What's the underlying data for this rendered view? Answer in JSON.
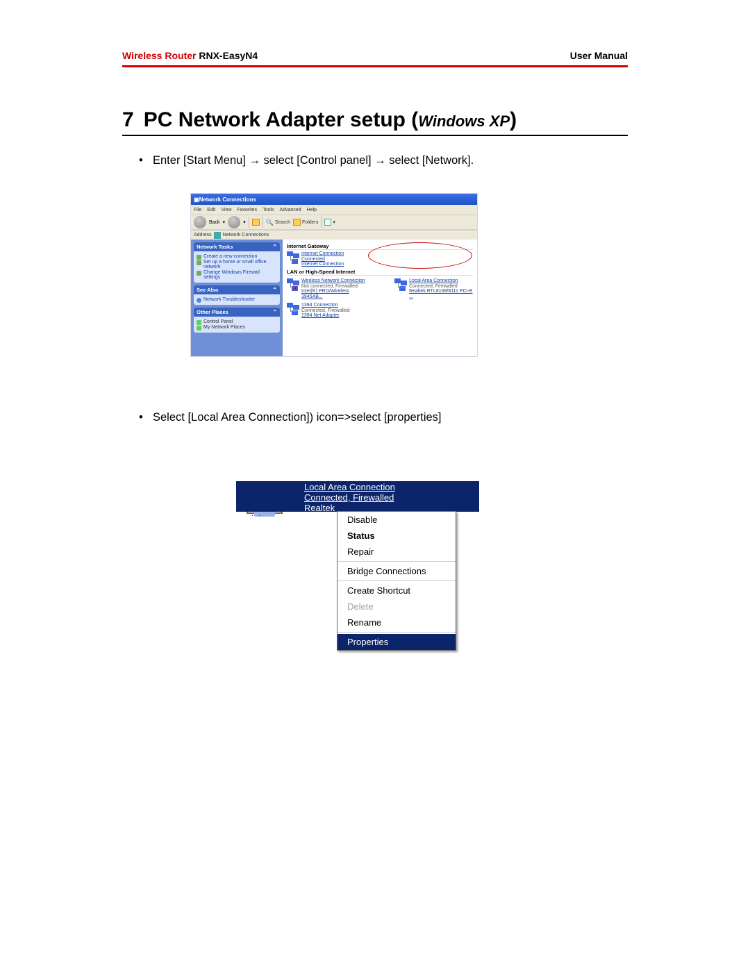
{
  "header": {
    "brand_red": "Wireless Router",
    "brand_black": " RNX-EasyN4",
    "right": "User Manual"
  },
  "heading": {
    "num": "7",
    "title": "PC Network Adapter setup (",
    "sub": "Windows XP",
    "close": ")"
  },
  "bullets": {
    "b1": "Enter [Start Menu] → select [Control panel] → select [Network].",
    "b2": "Select [Local Area Connection]) icon=>select [properties]"
  },
  "shot1": {
    "title": "Network Connections",
    "menu": {
      "file": "File",
      "edit": "Edit",
      "view": "View",
      "fav": "Favorites",
      "tools": "Tools",
      "adv": "Advanced",
      "help": "Help"
    },
    "toolbar": {
      "back": "Back",
      "search": "Search",
      "folders": "Folders"
    },
    "addr": {
      "label": "Address",
      "value": "Network Connections"
    },
    "panel_tasks": {
      "title": "Network Tasks",
      "items": [
        "Create a new connection",
        "Set up a home or small office network",
        "Change Windows Firewall settings"
      ]
    },
    "panel_seealso": {
      "title": "See Also",
      "item": "Network Troubleshooter"
    },
    "panel_other": {
      "title": "Other Places",
      "items": [
        "Control Panel",
        "My Network Places"
      ]
    },
    "grp_gateway": "Internet Gateway",
    "ic": {
      "name": "Internet Connection",
      "status": "Connected",
      "sub": "Internet Connection"
    },
    "grp_lan": "LAN or High-Speed Internet",
    "wnc": {
      "name": "Wireless Network Connection",
      "status": "Not connected, Firewalled",
      "sub": "Intel(R) PRO/Wireless 3945AB..."
    },
    "lac": {
      "name": "Local Area Connection",
      "status": "Connected, Firewalled",
      "sub": "Realtek RTL8168/8111 PCI-E ..."
    },
    "c1394": {
      "name": "1394 Connection",
      "status": "Connected, Firewalled",
      "sub": "1394 Net Adapter"
    }
  },
  "shot2": {
    "line1": "Local Area Connection",
    "line2": "Connected, Firewalled",
    "line3": "Realtek",
    "menu": {
      "disable": "Disable",
      "status": "Status",
      "repair": "Repair",
      "bridge": "Bridge Connections",
      "shortcut": "Create Shortcut",
      "delete": "Delete",
      "rename": "Rename",
      "properties": "Properties"
    }
  }
}
